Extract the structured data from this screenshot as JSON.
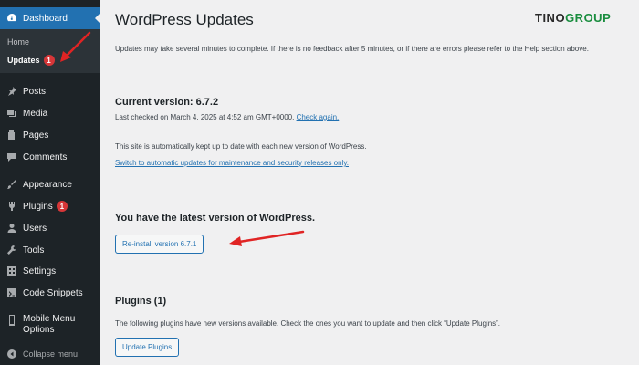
{
  "sidebar": {
    "dashboard": "Dashboard",
    "home": "Home",
    "updates": "Updates",
    "updates_badge": "1",
    "posts": "Posts",
    "media": "Media",
    "pages": "Pages",
    "comments": "Comments",
    "appearance": "Appearance",
    "plugins": "Plugins",
    "plugins_badge": "1",
    "users": "Users",
    "tools": "Tools",
    "settings": "Settings",
    "code_snippets": "Code Snippets",
    "mobile_menu_line1": "Mobile Menu",
    "mobile_menu_line2": "Options",
    "collapse": "Collapse menu"
  },
  "main": {
    "title": "WordPress Updates",
    "logo_part1": "TINO",
    "logo_part2": "GROUP",
    "intro": "Updates may take several minutes to complete. If there is no feedback after 5 minutes, or if there are errors please refer to the Help section above.",
    "current_version": "Current version: 6.7.2",
    "last_checked": "Last checked on March 4, 2025 at 4:52 am GMT+0000.",
    "check_again": "Check again.",
    "auto_update_text": "This site is automatically kept up to date with each new version of WordPress.",
    "switch_link": "Switch to automatic updates for maintenance and security releases only.",
    "latest_heading": "You have the latest version of WordPress.",
    "reinstall_button": "Re-install version 6.7.1",
    "plugins_heading": "Plugins (1)",
    "plugins_text": "The following plugins have new versions available. Check the ones you want to update and then click “Update Plugins”.",
    "update_plugins_button": "Update Plugins"
  },
  "colors": {
    "accent": "#2271b1",
    "sidebar": "#1d2327",
    "badge": "#d63638",
    "arrow": "#e02424"
  }
}
